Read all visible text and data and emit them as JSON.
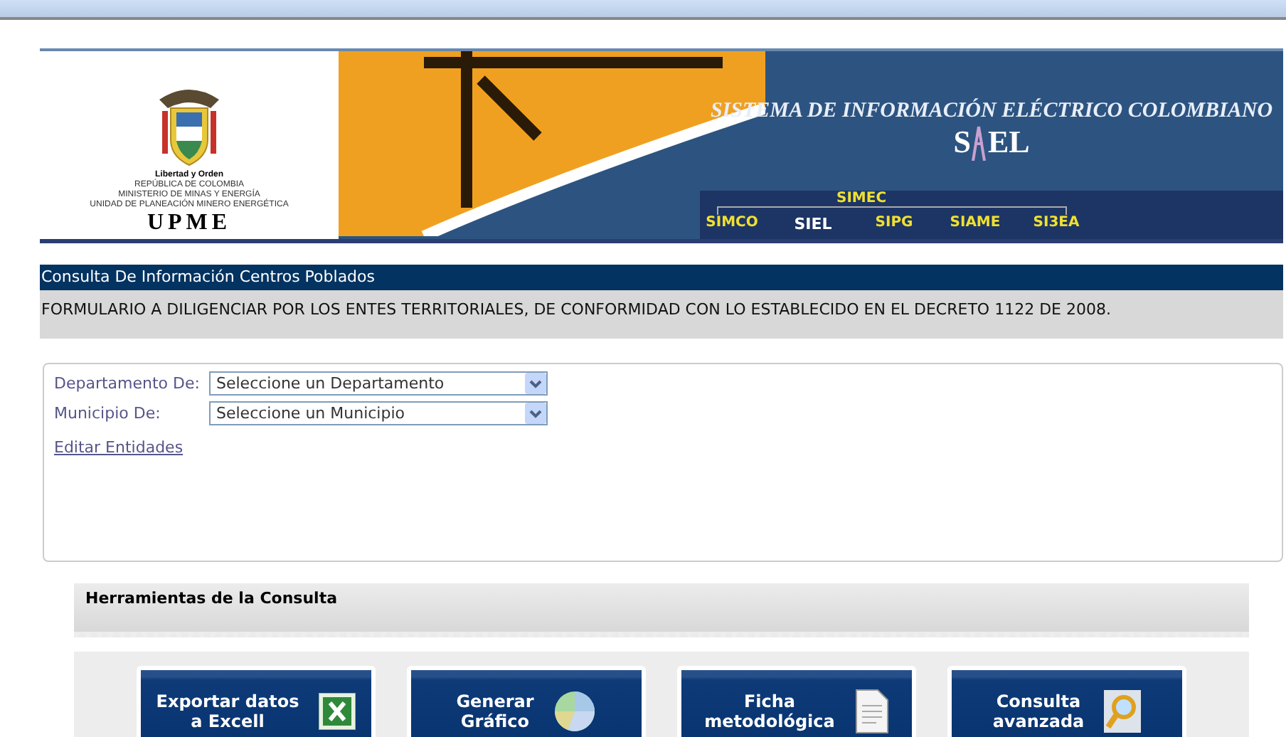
{
  "header": {
    "emblem_lines": [
      "Libertad y Orden",
      "REPÚBLICA DE COLOMBIA",
      "MINISTERIO DE MINAS Y ENERGÍA",
      "UNIDAD DE PLANEACIÓN MINERO ENERGÉTICA"
    ],
    "emblem_name": "UPME",
    "title": "SISTEMA DE  INFORMACIÓN ELÉCTRICO COLOMBIANO",
    "logo_text": [
      "S",
      "EL"
    ],
    "group_label": "SIMEC",
    "nav": [
      {
        "label": "SIMCO",
        "selected": false
      },
      {
        "label": "SIEL",
        "selected": true
      },
      {
        "label": "SIPG",
        "selected": false
      },
      {
        "label": "SIAME",
        "selected": false
      },
      {
        "label": "SI3EA",
        "selected": false
      }
    ]
  },
  "page_title": "Consulta De Información Centros Poblados",
  "notice": "FORMULARIO A DILIGENCIAR POR LOS ENTES TERRITORIALES, DE CONFORMIDAD CON LO ESTABLECIDO EN EL DECRETO 1122 DE 2008.",
  "form": {
    "fields": [
      {
        "label": "Departamento De:",
        "value": "Seleccione un Departamento"
      },
      {
        "label": "Municipio De:",
        "value": "Seleccione un Municipio"
      }
    ],
    "link": "Editar Entidades"
  },
  "tools": {
    "title": "Herramientas de la Consulta",
    "buttons": [
      {
        "lines": [
          "Exportar datos",
          "a Excell"
        ],
        "kind": "excel"
      },
      {
        "lines": [
          "Generar",
          "Gráfico"
        ],
        "kind": "chart"
      },
      {
        "lines": [
          "Ficha",
          "metodológica"
        ],
        "kind": "document"
      },
      {
        "lines": [
          "Consulta",
          "avanzada"
        ],
        "kind": "search"
      }
    ]
  }
}
